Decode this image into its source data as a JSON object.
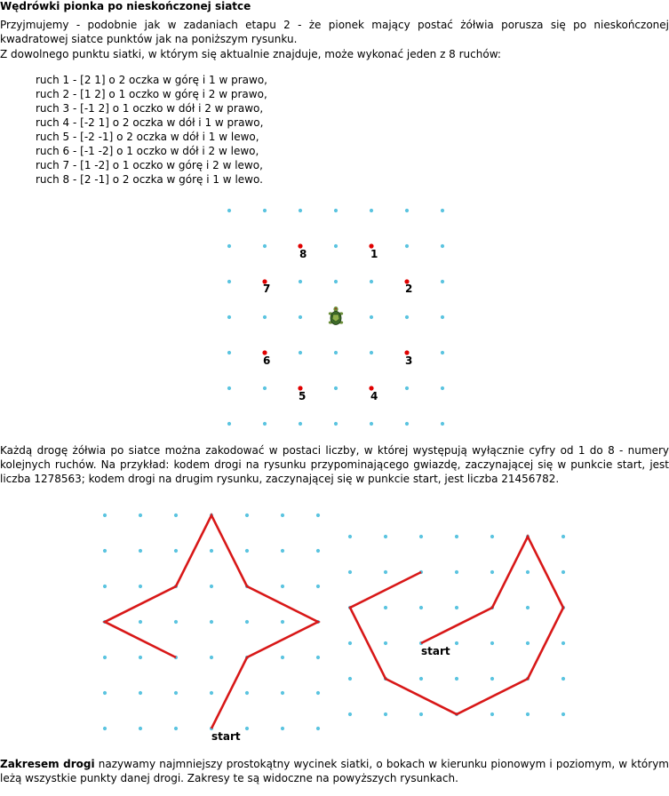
{
  "title": "Wędrówki pionka po nieskończonej siatce",
  "intro_1": "Przyjmujemy - podobnie jak w zadaniach etapu 2 - że pionek mający postać żółwia porusza się po nieskończonej kwadratowej siatce punktów jak na poniższym rysunku.",
  "intro_2": "Z dowolnego punktu siatki, w którym się aktualnie znajduje, może wykonać jeden z 8 ruchów:",
  "moves": [
    "ruch 1 - [2 1] o 2 oczka w górę i 1 w prawo,",
    "ruch 2 - [1 2] o 1 oczko w górę i 2 w prawo,",
    "ruch 3 - [-1 2] o 1 oczko w dół i 2 w prawo,",
    "ruch 4 - [-2 1] o 2 oczka w dół i 1 w prawo,",
    "ruch 5 - [-2 -1] o 2 oczka w dół i 1 w lewo,",
    "ruch 6 - [-1 -2] o 1 oczko w dół i 2 w lewo,",
    "ruch 7 - [1 -2] o 1 oczko w górę i 2 w lewo,",
    "ruch 8 - [2 -1] o 2 oczka w górę i 1 w lewo."
  ],
  "move_numbers": [
    "1",
    "2",
    "3",
    "4",
    "5",
    "6",
    "7",
    "8"
  ],
  "paragraph_2": "Każdą drogę żółwia po siatce można zakodować w postaci liczby, w której występują wyłącznie cyfry od 1 do 8 - numery kolejnych ruchów. Na przykład: kodem drogi na rysunku przypominającego gwiazdę, zaczynającej się w punkcie start, jest liczba 1278563; kodem drogi na drugim rysunku, zaczynającej się w punkcie start, jest liczba 21456782.",
  "start_label_1": "start",
  "start_label_2": "start",
  "footer_bold": "Zakresem drogi",
  "footer_rest": " nazywamy najmniejszy prostokątny wycinek siatki, o bokach w kierunku pionowym i poziomym, w którym leżą wszystkie punkty danej drogi. Zakresy te są widoczne na powyższych rysunkach.",
  "colors": {
    "grid_dot": "#5bc4e0",
    "target_dot": "#e00000",
    "path": "#d81818",
    "turtle_shell": "#3d6b2a"
  },
  "icons": {
    "turtle": "turtle-icon"
  }
}
